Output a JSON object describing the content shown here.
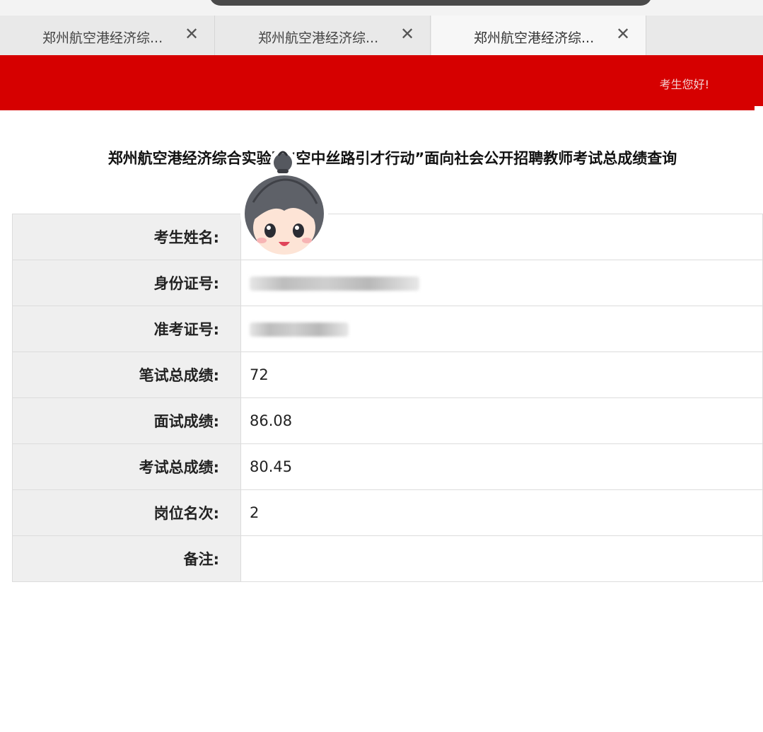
{
  "tabs": [
    {
      "title": "郑州航空港经济综..."
    },
    {
      "title": "郑州航空港经济综..."
    },
    {
      "title": "郑州航空港经济综..."
    }
  ],
  "tab_close_symbol": "✕",
  "header": {
    "greeting": "考生您好!",
    "color": "#d60000"
  },
  "page_title": "郑州航空港经济综合实验区“空中丝路引才行动”面向社会公开招聘教师考试总成绩查询",
  "result_rows": [
    {
      "label": "考生姓名:",
      "value": ""
    },
    {
      "label": "身份证号:",
      "value": ""
    },
    {
      "label": "准考证号:",
      "value": ""
    },
    {
      "label": "笔试总成绩:",
      "value": "72"
    },
    {
      "label": "面试成绩:",
      "value": "86.08"
    },
    {
      "label": "考试总成绩:",
      "value": "80.45"
    },
    {
      "label": "岗位名次:",
      "value": "2"
    },
    {
      "label": "备注:",
      "value": ""
    }
  ],
  "icons": {
    "mascot": "cartoon-face-sticker-icon",
    "close": "close-icon"
  }
}
